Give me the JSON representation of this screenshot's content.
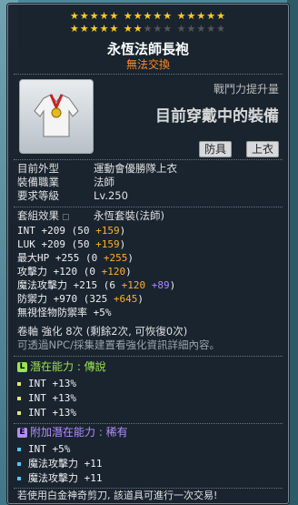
{
  "stars": {
    "row1": "★★★★★  ★★★★★  ★★★★★",
    "row2_on": "★★★★★  ★★",
    "row2_off": "★★★  ★★★★★"
  },
  "item": {
    "name": "永恆法師長袍",
    "trade": "無法交換",
    "combat_power_label": "戰鬥力提升量",
    "equipped_text": "目前穿戴中的裝備",
    "tags": [
      "防具",
      "上衣"
    ]
  },
  "info": [
    {
      "label": "目前外型",
      "value": "運動會優勝隊上衣"
    },
    {
      "label": "裝備職業",
      "value": "法師"
    },
    {
      "label": "要求等級",
      "value": "Lv.250"
    }
  ],
  "set_effect": {
    "label": "套組效果",
    "value": "永恆套裝(法師)"
  },
  "stats": [
    {
      "name": "INT",
      "total": "+209",
      "base": "(50",
      "bonus": "+159",
      "extra": "",
      "end": ")"
    },
    {
      "name": "LUK",
      "total": "+209",
      "base": "(50",
      "bonus": "+159",
      "extra": "",
      "end": ")"
    },
    {
      "name": "最大HP",
      "total": "+255",
      "base": "(0",
      "bonus": "+255",
      "extra": "",
      "end": ")"
    },
    {
      "name": "攻擊力",
      "total": "+120",
      "base": "(0",
      "bonus": "+120",
      "extra": "",
      "end": ")"
    },
    {
      "name": "魔法攻擊力",
      "total": "+215",
      "base": "(6",
      "bonus": "+120",
      "extra": "+89",
      "end": ")"
    },
    {
      "name": "防禦力",
      "total": "+970",
      "base": "(325",
      "bonus": "+645",
      "extra": "",
      "end": ")"
    },
    {
      "name": "無視怪物防禦率",
      "total": "+5%",
      "base": "",
      "bonus": "",
      "extra": "",
      "end": ""
    }
  ],
  "scroll": {
    "line": "卷軸 強化 8次 (剩餘2次, 可恢復0次)",
    "note": "可透過NPC/採集建置看強化資訊詳細內容。"
  },
  "potential": {
    "badge": "L",
    "label": "潛在能力 : 傳說",
    "lines": [
      "INT +13%",
      "INT +13%",
      "INT +13%"
    ],
    "color": "#9de24f"
  },
  "additional": {
    "badge": "E",
    "label": "附加潛在能力 : 稀有",
    "lines": [
      "INT +5%",
      "魔法攻擊力 +11",
      "魔法攻擊力 +11"
    ],
    "color": "#b58cff",
    "line_color": "#4fc8ff"
  },
  "footer": "若使用白金神奇剪刀, 該道具可進行一次交易!"
}
